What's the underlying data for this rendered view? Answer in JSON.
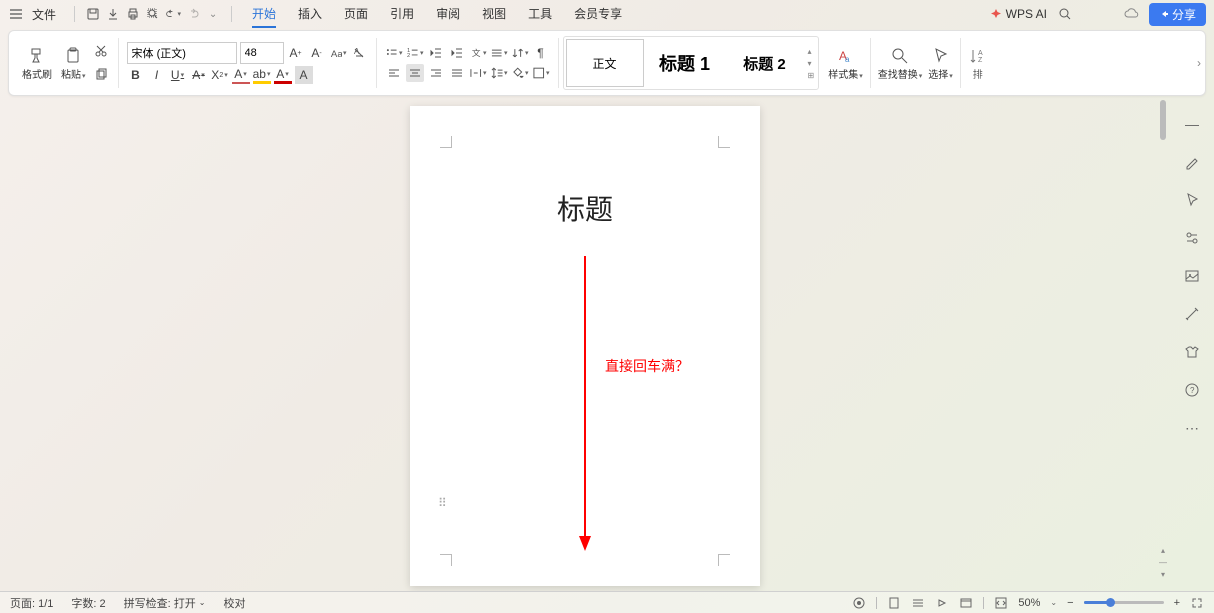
{
  "menubar": {
    "file": "文件",
    "tabs": [
      "开始",
      "插入",
      "页面",
      "引用",
      "审阅",
      "视图",
      "工具",
      "会员专享"
    ],
    "active_tab": 0,
    "wps_ai": "WPS AI",
    "share": "分享"
  },
  "ribbon": {
    "format_painter": "格式刷",
    "paste": "粘贴",
    "font_name": "宋体 (正文)",
    "font_size": "48",
    "styles": {
      "body": "正文",
      "h1": "标题 1",
      "h2": "标题 2"
    },
    "style_set": "样式集",
    "find_replace": "查找替换",
    "select": "选择",
    "sort_truncated": "排"
  },
  "document": {
    "title": "标题",
    "annotation": "直接回车满？"
  },
  "statusbar": {
    "page": "页面: 1/1",
    "words": "字数: 2",
    "spellcheck": "拼写检查: 打开",
    "proof": "校对",
    "zoom": "50%"
  }
}
